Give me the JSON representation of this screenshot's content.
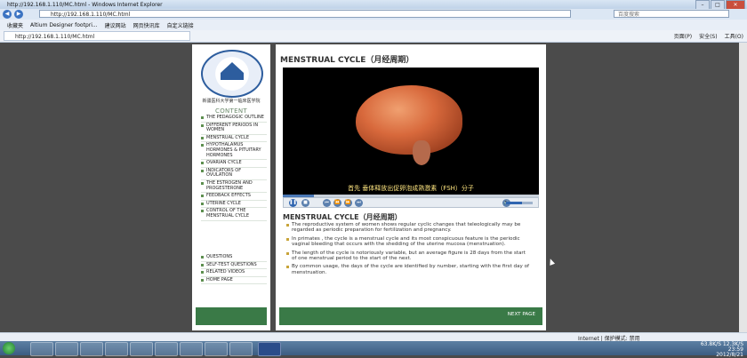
{
  "window": {
    "title": "http://192.168.1.110/MC.html - Windows Internet Explorer",
    "address": "http://192.168.1.110/MC.html",
    "search_placeholder": "百度搜索"
  },
  "favorites": [
    "收藏夹",
    "Altium Designer footpri...",
    "建议网站",
    "网页快讯库",
    "自定义链接"
  ],
  "tab": {
    "label": "http://192.168.1.110/MC.html"
  },
  "command_bar": [
    "页面(P)",
    "安全(S)",
    "工具(O)"
  ],
  "sidebar": {
    "university": "新疆医科大学第一临床医学院",
    "content_heading": "CONTENT",
    "items": [
      "THE PEDAGOGIC OUTLINE",
      "DIFFERENT PERIODS IN WOMEN",
      "MENSTRUAL CYCLE",
      "HYPOTHALAMUS HORMONES & PITUITARY HORMONES",
      "OVARIAN CYCLE",
      "INDICATORS OF OVULATION",
      "THE ESTROGEN AND PROGESTERONE",
      "FEEDBACK EFFECTS",
      "UTERINE CYCLE",
      "CONTROL OF THE MENSTRUAL CYCLE"
    ],
    "bottom_items": [
      "QUESTIONS",
      "SELF-TEST QUESTIONS",
      "RELATED VIDEOS",
      "HOME PAGE"
    ]
  },
  "main": {
    "title": "MENSTRUAL CYCLE（月经周期）",
    "video_subtitle": "首先  垂体释放出促卵泡成熟激素（FSH）分子",
    "video_progress": 0.12,
    "volume_level": 0.6,
    "section_title": "MENSTRUAL CYCLE（月经周期）",
    "paragraphs": [
      "The reproductive system of women shows regular cyclic changes that teleologically may be regarded as periodic preparation for fertilization and pregnancy.",
      "In primates , the cycle is a menstrual cycle and its most conspicuous feature is the periodic vaginal bleeding that occurs with the shedding of the uterine mucosa (menstruation).",
      "The length of the cycle is notoriously variable, but an average figure is 28 days from the start of one menstrual period to the start of the next.",
      "By common usage, the days of the cycle are identified by number, starting with the first day of menstruation."
    ],
    "next_label": "NEXT PAGE"
  },
  "status": {
    "zone": "Internet | 保护模式: 禁用"
  },
  "tray": {
    "net": "63.8K/S  12.3K/S",
    "time": "23:59",
    "date": "2012/8/21"
  },
  "colors": {
    "accent_green": "#3a7a47",
    "title_text": "#333333",
    "bullet": "#5d8f4f"
  }
}
